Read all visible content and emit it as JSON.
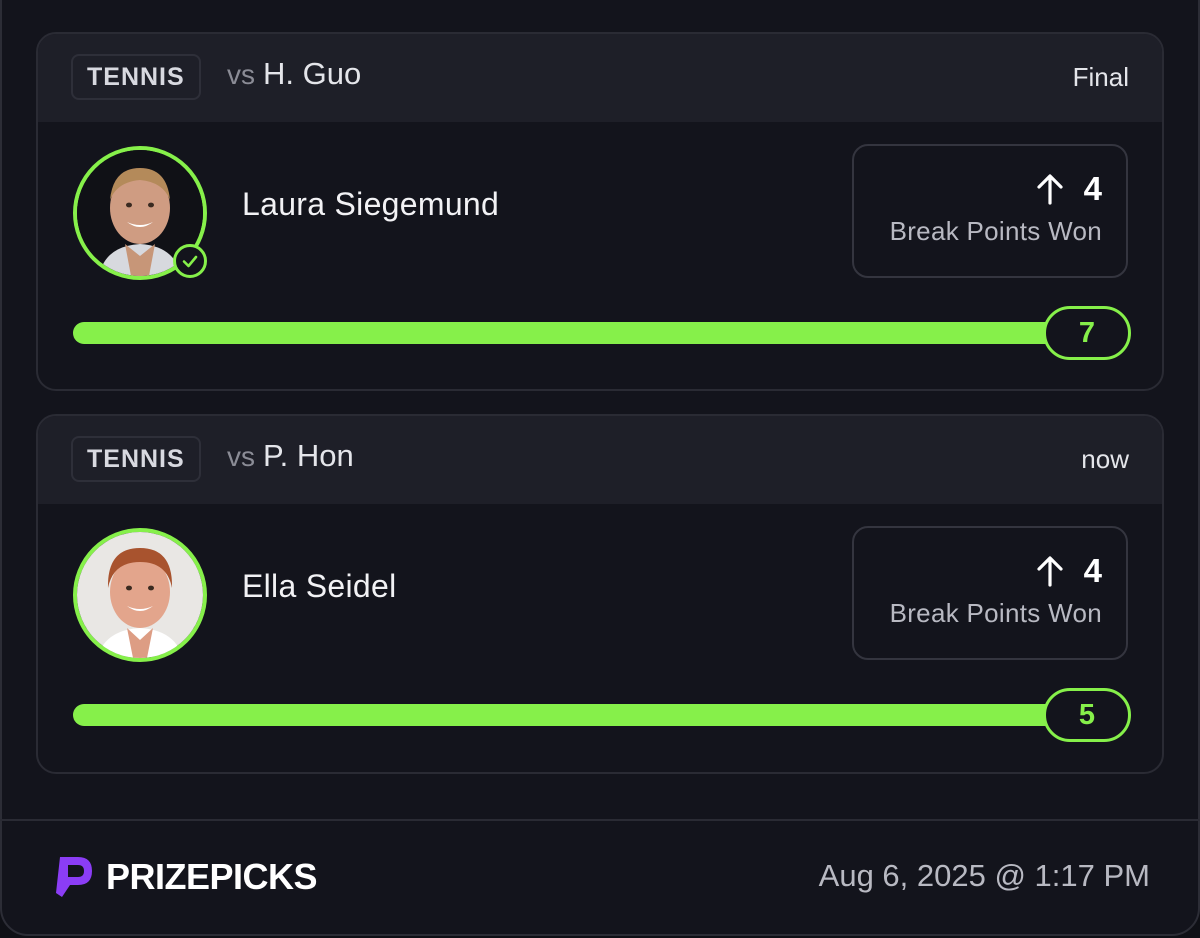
{
  "cards": [
    {
      "sport": "TENNIS",
      "vs": "vs",
      "opponent": "H. Guo",
      "status": "Final",
      "player": "Laura Siegemund",
      "stat_value": "4",
      "stat_label": "Break Points Won",
      "direction_icon": "arrow-up-icon",
      "result_value": "7",
      "progress_fraction": 1.0,
      "show_check": true
    },
    {
      "sport": "TENNIS",
      "vs": "vs",
      "opponent": "P. Hon",
      "status": "now",
      "player": "Ella Seidel",
      "stat_value": "4",
      "stat_label": "Break Points Won",
      "direction_icon": "arrow-up-icon",
      "result_value": "5",
      "progress_fraction": 1.0,
      "show_check": false
    }
  ],
  "footer": {
    "brand": "PRIZEPICKS",
    "timestamp": "Aug 6, 2025 @ 1:17 PM"
  },
  "colors": {
    "accent": "#86f04a",
    "background": "#13141c",
    "header": "#1e1f28",
    "brand_purple": "#8b3df5"
  }
}
